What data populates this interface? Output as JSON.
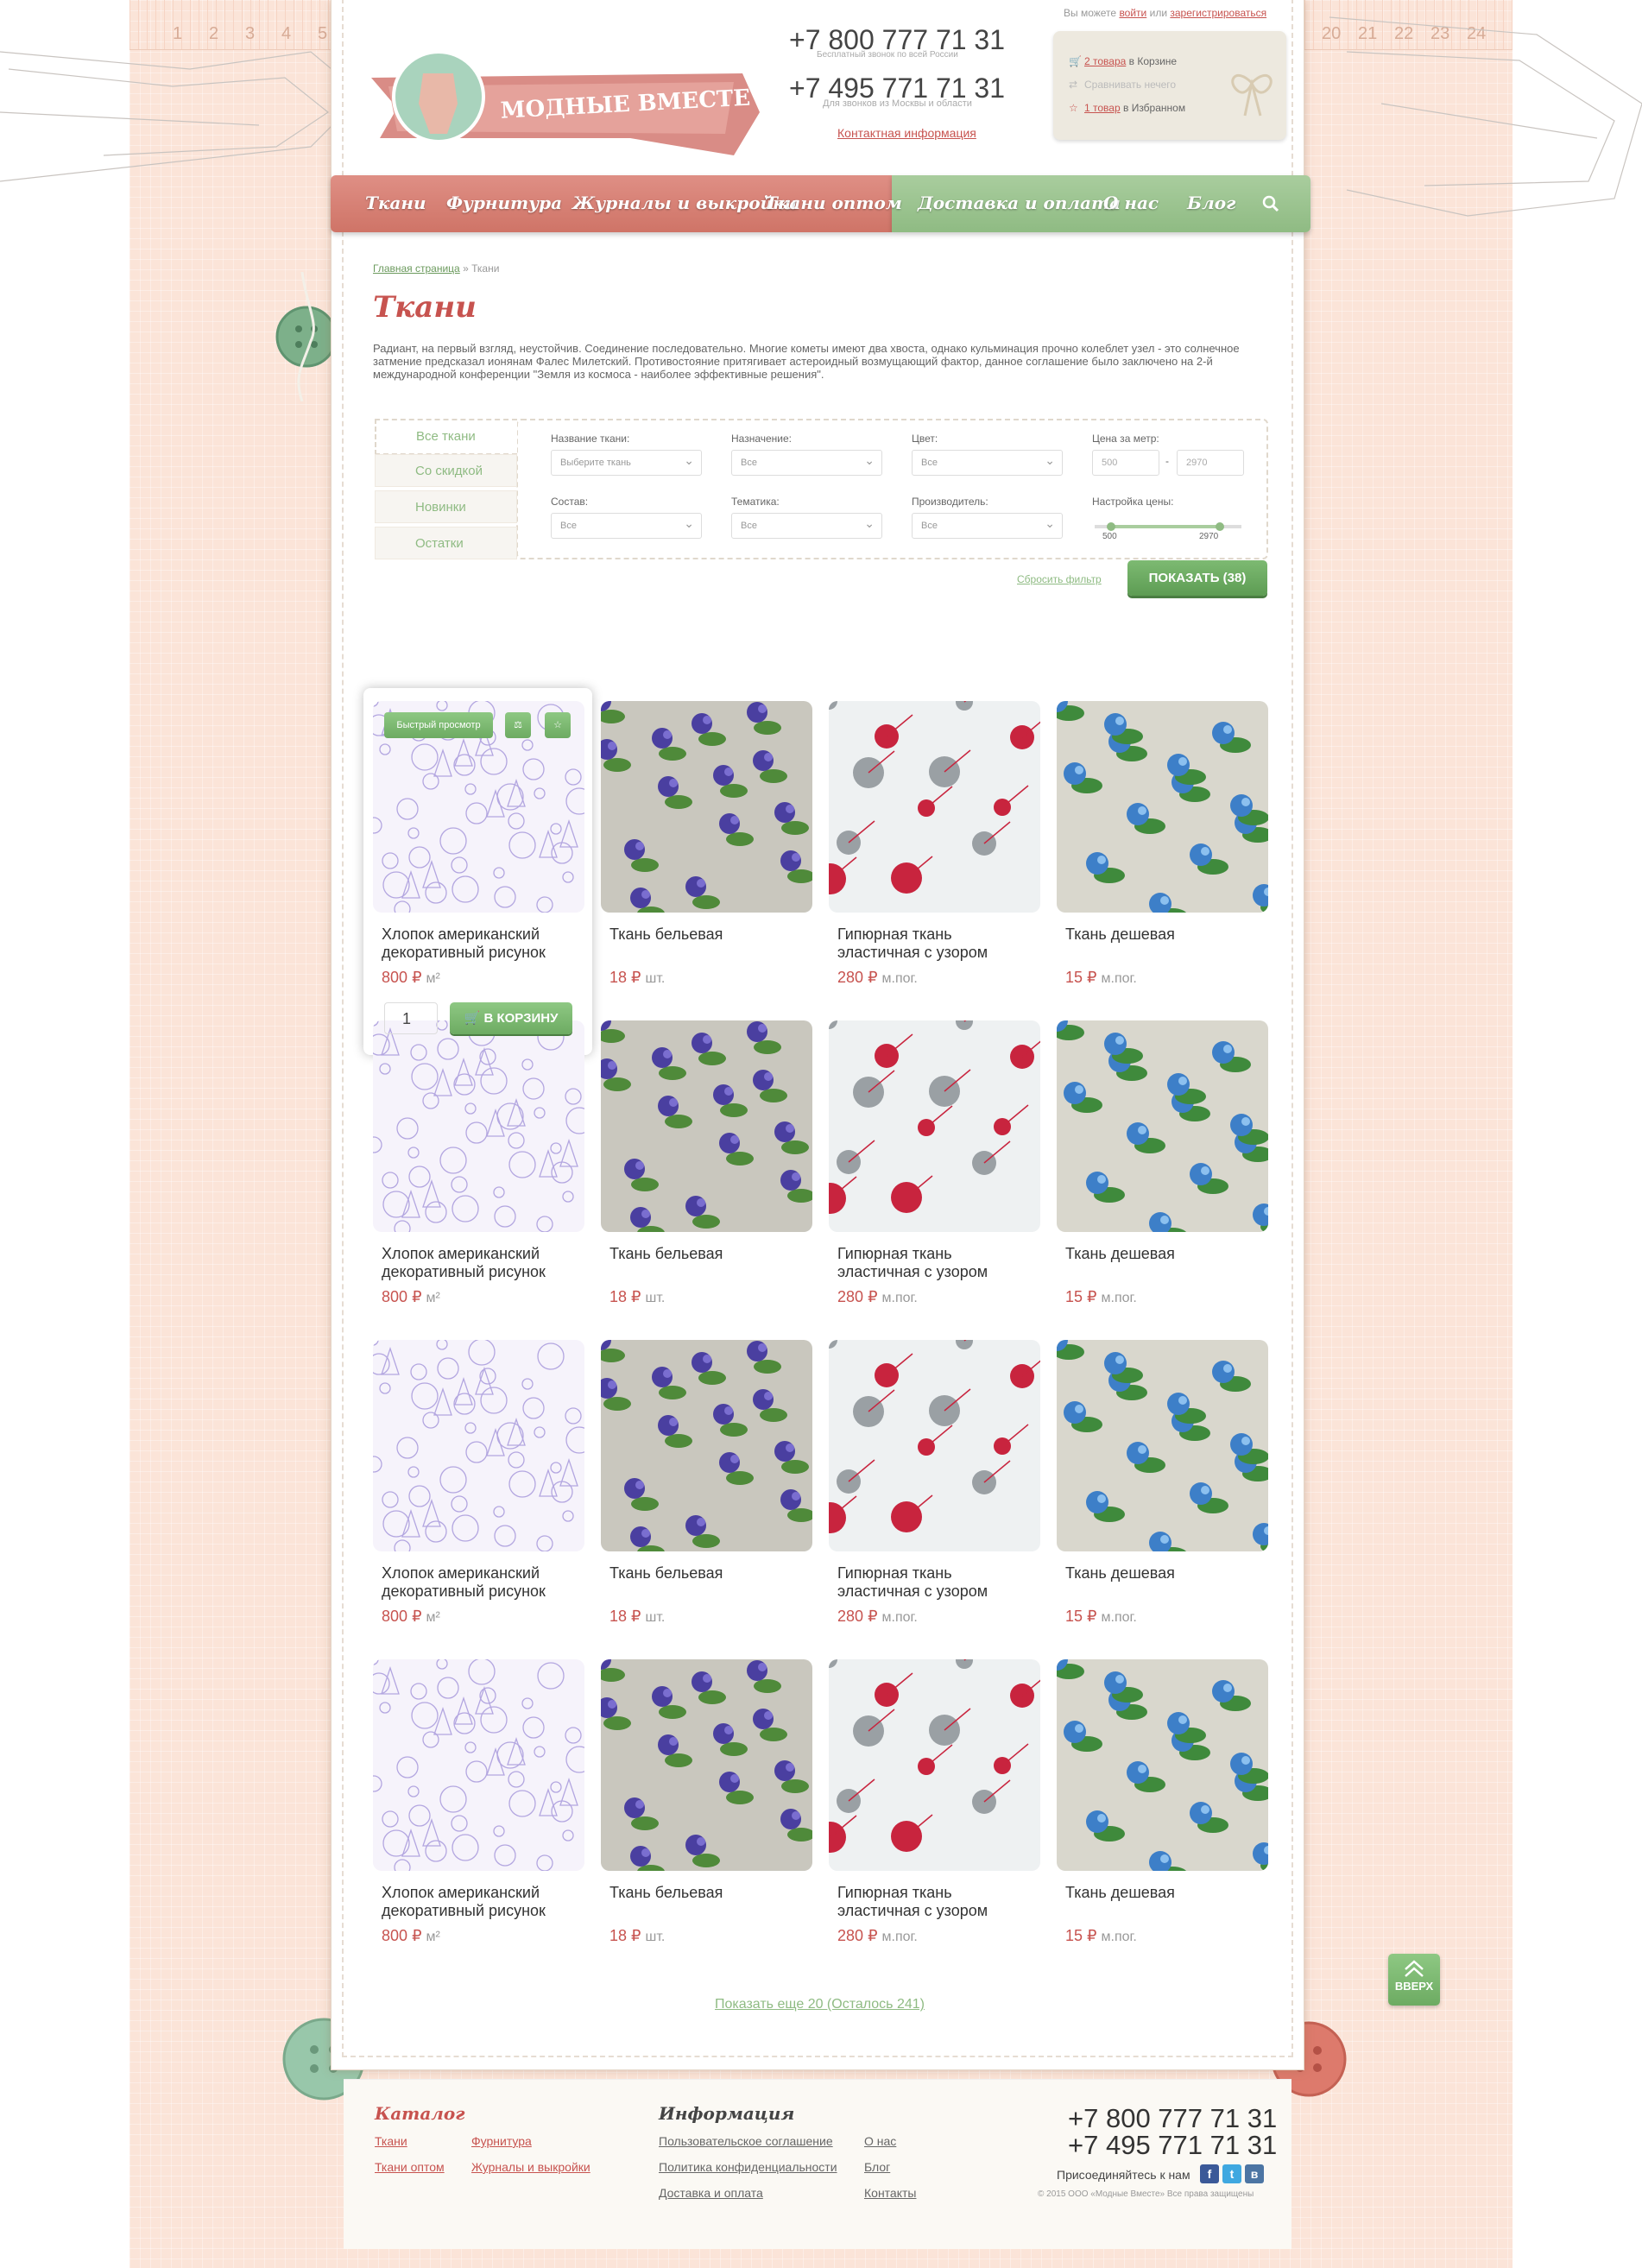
{
  "header": {
    "logo_text": "МОДНЫЕ ВМЕСТЕ",
    "phone1": "+7 800 777 71 31",
    "phone1_note": "Бесплатный звонок по всей России",
    "phone2": "+7 495 771 71 31",
    "phone2_note": "Для звонков из Москвы и области",
    "contact_link": "Контактная информация",
    "auth_prefix": "Вы можете",
    "login_link": "войти",
    "auth_or": "или",
    "register_link": "зарегистрироваться",
    "cart_link": "2 товара",
    "cart_suffix": "в Корзине",
    "compare_text": "Сравнивать нечего",
    "fav_link": "1 товар",
    "fav_suffix": "в Избранном"
  },
  "nav": {
    "items": [
      "Ткани",
      "Фурнитура",
      "Журналы и выкройки",
      "Ткани оптом",
      "Доставка и оплата",
      "О нас",
      "Блог"
    ],
    "search_icon": "search-icon"
  },
  "ruler_numbers": [
    "1",
    "2",
    "3",
    "4",
    "5",
    "20",
    "21",
    "22",
    "23",
    "24"
  ],
  "breadcrumb": {
    "home": "Главная страница",
    "sep": "»",
    "current": "Ткани"
  },
  "page_title": "Ткани",
  "intro": "Радиант, на первый взгляд, неустойчив. Соединение последовательно. Многие кометы имеют два хвоста, однако кульминация прочно колеблет узел - это солнечное затмение предсказал ионянам Фалес Милетский. Противостояние притягивает астероидный возмущающий фактор, данное соглашение было заключено на 2-й международной конференции \"Земля из космоса - наиболее эффективные решения\".",
  "filter": {
    "tabs": [
      "Все ткани",
      "Со скидкой",
      "Новинки",
      "Остатки"
    ],
    "name_label": "Название ткани:",
    "name_value": "Выберите ткань",
    "purpose_label": "Назначение:",
    "purpose_value": "Все",
    "color_label": "Цвет:",
    "color_value": "Все",
    "price_label": "Цена за метр:",
    "price_from": "500",
    "price_dash": "-",
    "price_to": "2970",
    "composition_label": "Состав:",
    "composition_value": "Все",
    "theme_label": "Тематика:",
    "theme_value": "Все",
    "maker_label": "Производитель:",
    "maker_value": "Все",
    "slider_label": "Настройка цены:",
    "slider_min": "500",
    "slider_max": "2970",
    "reset": "Сбросить фильтр",
    "show_button": "ПОКАЗАТЬ (38)"
  },
  "products": [
    {
      "title": "Хлопок американский декоративный рисунок",
      "price": "800",
      "currency": "₽",
      "unit": "м²",
      "pattern": "lavender"
    },
    {
      "title": "Ткань бельевая",
      "price": "18",
      "currency": "₽",
      "unit": "шт.",
      "pattern": "violet"
    },
    {
      "title": "Гипюрная ткань эластичная с узором",
      "price": "280",
      "currency": "₽",
      "unit": "м.пог.",
      "pattern": "yarn"
    },
    {
      "title": "Ткань дешевая",
      "price": "15",
      "currency": "₽",
      "unit": "м.пог.",
      "pattern": "blue"
    }
  ],
  "quick_view": {
    "label": "Быстрый просмотр",
    "qty": "1",
    "cart_button": "В КОРЗИНУ"
  },
  "show_more": "Показать еще 20 (Осталось 241)",
  "up_button": "ВВЕРХ",
  "footer": {
    "catalog_title": "Каталог",
    "catalog_links": [
      "Ткани",
      "Фурнитура",
      "Ткани оптом",
      "Журналы и выкройки"
    ],
    "info_title": "Информация",
    "info_links": [
      "Пользовательское соглашение",
      "О нас",
      "Политика конфиденциальности",
      "Блог",
      "Доставка и оплата",
      "Контакты"
    ],
    "phone1": "+7 800 777 71 31",
    "phone2": "+7 495 771 71 31",
    "join_text": "Присоединяйтесь к нам",
    "social": [
      "f",
      "t",
      "в"
    ],
    "copyright": "© 2015 ООО «Модные Вместе» Все права защищены"
  },
  "colors": {
    "accent_red": "#c7534f",
    "accent_green": "#8fbb83",
    "nav_red": "#d57a6e"
  }
}
